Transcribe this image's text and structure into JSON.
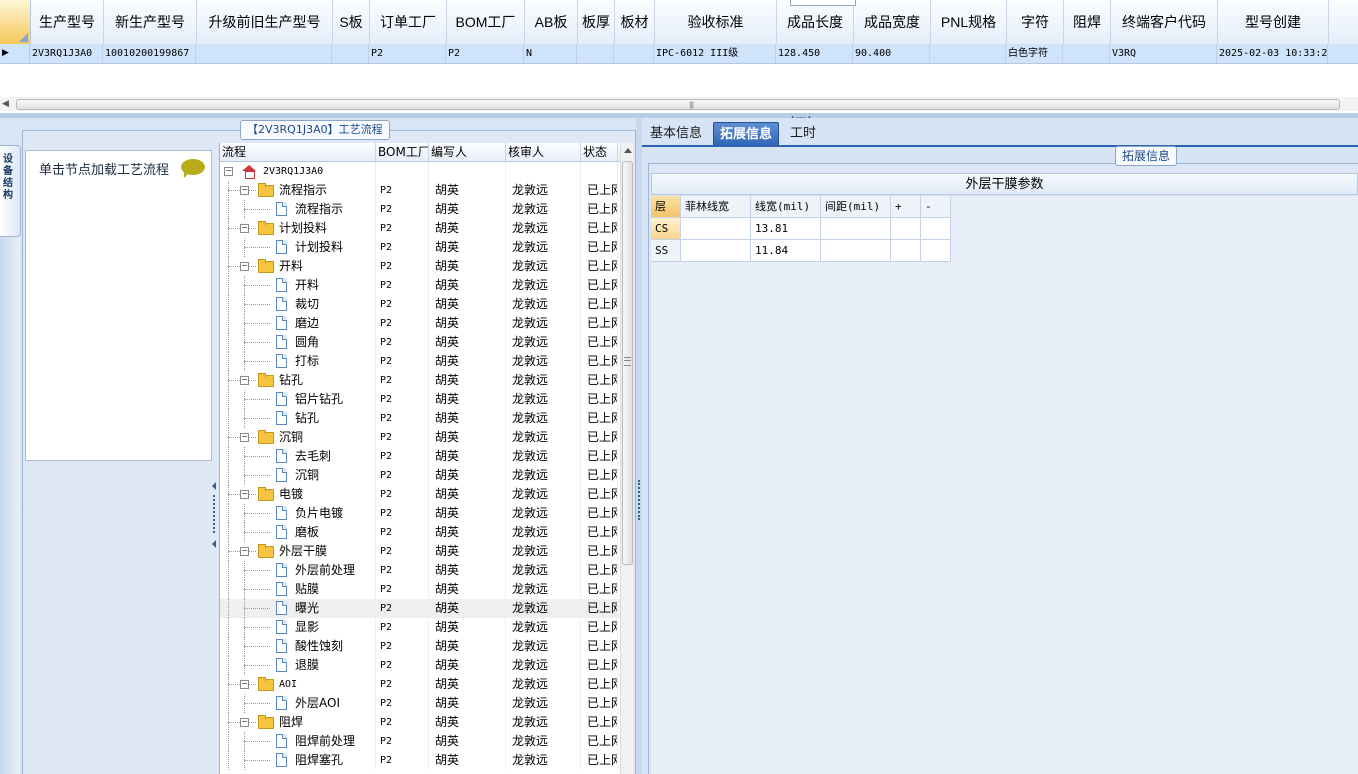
{
  "top_grid": {
    "columns": [
      {
        "label": "生产型号",
        "w": 73
      },
      {
        "label": "新生产型号",
        "w": 93
      },
      {
        "label": "升级前旧生产型号",
        "w": 136
      },
      {
        "label": "S板",
        "w": 37
      },
      {
        "label": "订单工厂",
        "w": 77
      },
      {
        "label": "BOM工厂",
        "w": 78
      },
      {
        "label": "AB板",
        "w": 53
      },
      {
        "label": "板厚",
        "w": 37
      },
      {
        "label": "板材",
        "w": 40
      },
      {
        "label": "验收标准",
        "w": 122
      },
      {
        "label": "成品长度",
        "w": 77
      },
      {
        "label": "成品宽度",
        "w": 77
      },
      {
        "label": "PNL规格",
        "w": 76
      },
      {
        "label": "字符",
        "w": 57
      },
      {
        "label": "阻焊",
        "w": 47
      },
      {
        "label": "终端客户代码",
        "w": 107
      },
      {
        "label": "型号创建",
        "w": 111
      }
    ],
    "row": [
      "2V3RQ1J3A0",
      "10010200199867",
      "",
      "",
      "P2",
      "P2",
      "N",
      "",
      "",
      "IPC-6012 III级",
      "128.450",
      "90.400",
      "",
      "白色字符",
      "",
      "V3RQ",
      "2025-02-03 10:33:24"
    ],
    "row_indicator": "▶"
  },
  "left_panel": {
    "side_tab_label": "设备结构",
    "panel_title": "【2V3RQ1J3A0】工艺流程",
    "load_hint": "单击节点加载工艺流程"
  },
  "tree": {
    "headers": [
      "流程",
      "BOM工厂",
      "编写人",
      "核审人",
      "状态"
    ],
    "rows": [
      {
        "level": 0,
        "type": "root",
        "name": "2V3RQ1J3A0",
        "factory": "",
        "writer": "",
        "reviewer": "",
        "status": ""
      },
      {
        "level": 1,
        "type": "folder",
        "name": "流程指示",
        "factory": "P2",
        "writer": "胡英",
        "reviewer": "龙敦远",
        "status": "已上网"
      },
      {
        "level": 2,
        "type": "doc",
        "name": "流程指示",
        "factory": "P2",
        "writer": "胡英",
        "reviewer": "龙敦远",
        "status": "已上网"
      },
      {
        "level": 1,
        "type": "folder",
        "name": "计划投料",
        "factory": "P2",
        "writer": "胡英",
        "reviewer": "龙敦远",
        "status": "已上网"
      },
      {
        "level": 2,
        "type": "doc",
        "name": "计划投料",
        "factory": "P2",
        "writer": "胡英",
        "reviewer": "龙敦远",
        "status": "已上网"
      },
      {
        "level": 1,
        "type": "folder",
        "name": "开料",
        "factory": "P2",
        "writer": "胡英",
        "reviewer": "龙敦远",
        "status": "已上网"
      },
      {
        "level": 2,
        "type": "doc",
        "name": "开料",
        "factory": "P2",
        "writer": "胡英",
        "reviewer": "龙敦远",
        "status": "已上网"
      },
      {
        "level": 2,
        "type": "doc",
        "name": "裁切",
        "factory": "P2",
        "writer": "胡英",
        "reviewer": "龙敦远",
        "status": "已上网"
      },
      {
        "level": 2,
        "type": "doc",
        "name": "磨边",
        "factory": "P2",
        "writer": "胡英",
        "reviewer": "龙敦远",
        "status": "已上网"
      },
      {
        "level": 2,
        "type": "doc",
        "name": "圆角",
        "factory": "P2",
        "writer": "胡英",
        "reviewer": "龙敦远",
        "status": "已上网"
      },
      {
        "level": 2,
        "type": "doc",
        "name": "打标",
        "factory": "P2",
        "writer": "胡英",
        "reviewer": "龙敦远",
        "status": "已上网"
      },
      {
        "level": 1,
        "type": "folder",
        "name": "钻孔",
        "factory": "P2",
        "writer": "胡英",
        "reviewer": "龙敦远",
        "status": "已上网"
      },
      {
        "level": 2,
        "type": "doc",
        "name": "铝片钻孔",
        "factory": "P2",
        "writer": "胡英",
        "reviewer": "龙敦远",
        "status": "已上网"
      },
      {
        "level": 2,
        "type": "doc",
        "name": "钻孔",
        "factory": "P2",
        "writer": "胡英",
        "reviewer": "龙敦远",
        "status": "已上网"
      },
      {
        "level": 1,
        "type": "folder",
        "name": "沉铜",
        "factory": "P2",
        "writer": "胡英",
        "reviewer": "龙敦远",
        "status": "已上网"
      },
      {
        "level": 2,
        "type": "doc",
        "name": "去毛刺",
        "factory": "P2",
        "writer": "胡英",
        "reviewer": "龙敦远",
        "status": "已上网"
      },
      {
        "level": 2,
        "type": "doc",
        "name": "沉铜",
        "factory": "P2",
        "writer": "胡英",
        "reviewer": "龙敦远",
        "status": "已上网"
      },
      {
        "level": 1,
        "type": "folder",
        "name": "电镀",
        "factory": "P2",
        "writer": "胡英",
        "reviewer": "龙敦远",
        "status": "已上网"
      },
      {
        "level": 2,
        "type": "doc",
        "name": "负片电镀",
        "factory": "P2",
        "writer": "胡英",
        "reviewer": "龙敦远",
        "status": "已上网"
      },
      {
        "level": 2,
        "type": "doc",
        "name": "磨板",
        "factory": "P2",
        "writer": "胡英",
        "reviewer": "龙敦远",
        "status": "已上网"
      },
      {
        "level": 1,
        "type": "folder",
        "name": "外层干膜",
        "factory": "P2",
        "writer": "胡英",
        "reviewer": "龙敦远",
        "status": "已上网"
      },
      {
        "level": 2,
        "type": "doc",
        "name": "外层前处理",
        "factory": "P2",
        "writer": "胡英",
        "reviewer": "龙敦远",
        "status": "已上网"
      },
      {
        "level": 2,
        "type": "doc",
        "name": "贴膜",
        "factory": "P2",
        "writer": "胡英",
        "reviewer": "龙敦远",
        "status": "已上网"
      },
      {
        "level": 2,
        "type": "doc",
        "name": "曝光",
        "factory": "P2",
        "writer": "胡英",
        "reviewer": "龙敦远",
        "status": "已上网",
        "selected": true
      },
      {
        "level": 2,
        "type": "doc",
        "name": "显影",
        "factory": "P2",
        "writer": "胡英",
        "reviewer": "龙敦远",
        "status": "已上网"
      },
      {
        "level": 2,
        "type": "doc",
        "name": "酸性蚀刻",
        "factory": "P2",
        "writer": "胡英",
        "reviewer": "龙敦远",
        "status": "已上网"
      },
      {
        "level": 2,
        "type": "doc",
        "name": "退膜",
        "factory": "P2",
        "writer": "胡英",
        "reviewer": "龙敦远",
        "status": "已上网"
      },
      {
        "level": 1,
        "type": "folder",
        "name": "AOI",
        "factory": "P2",
        "writer": "胡英",
        "reviewer": "龙敦远",
        "status": "已上网"
      },
      {
        "level": 2,
        "type": "doc",
        "name": "外层AOI",
        "factory": "P2",
        "writer": "胡英",
        "reviewer": "龙敦远",
        "status": "已上网"
      },
      {
        "level": 1,
        "type": "folder",
        "name": "阻焊",
        "factory": "P2",
        "writer": "胡英",
        "reviewer": "龙敦远",
        "status": "已上网"
      },
      {
        "level": 2,
        "type": "doc",
        "name": "阻焊前处理",
        "factory": "P2",
        "writer": "胡英",
        "reviewer": "龙敦远",
        "status": "已上网"
      },
      {
        "level": 2,
        "type": "doc",
        "name": "阻焊塞孔",
        "factory": "P2",
        "writer": "胡英",
        "reviewer": "龙敦远",
        "status": "已上网"
      }
    ]
  },
  "right_panel": {
    "tabs": [
      {
        "label": "基本信息",
        "active": false
      },
      {
        "label": "拓展信息",
        "active": true
      },
      {
        "label": "工时",
        "active": false
      }
    ],
    "group_legend": "拓展信息",
    "film_title": "外层干膜参数",
    "film_headers": [
      "层",
      "菲林线宽",
      "线宽(mil)",
      "间距(mil)",
      "+",
      "-"
    ],
    "film_rows": [
      {
        "layer": "CS",
        "film_width": "",
        "line_width": "13.81",
        "spacing": "",
        "plus": "",
        "minus": ""
      },
      {
        "layer": "SS",
        "film_width": "",
        "line_width": "11.84",
        "spacing": "",
        "plus": "",
        "minus": ""
      }
    ]
  },
  "colors": {
    "accent": "#2d63b3",
    "selected_row": "#cfe4fa",
    "panel_bg": "#d8e5f4",
    "folder": "#f5c542"
  }
}
